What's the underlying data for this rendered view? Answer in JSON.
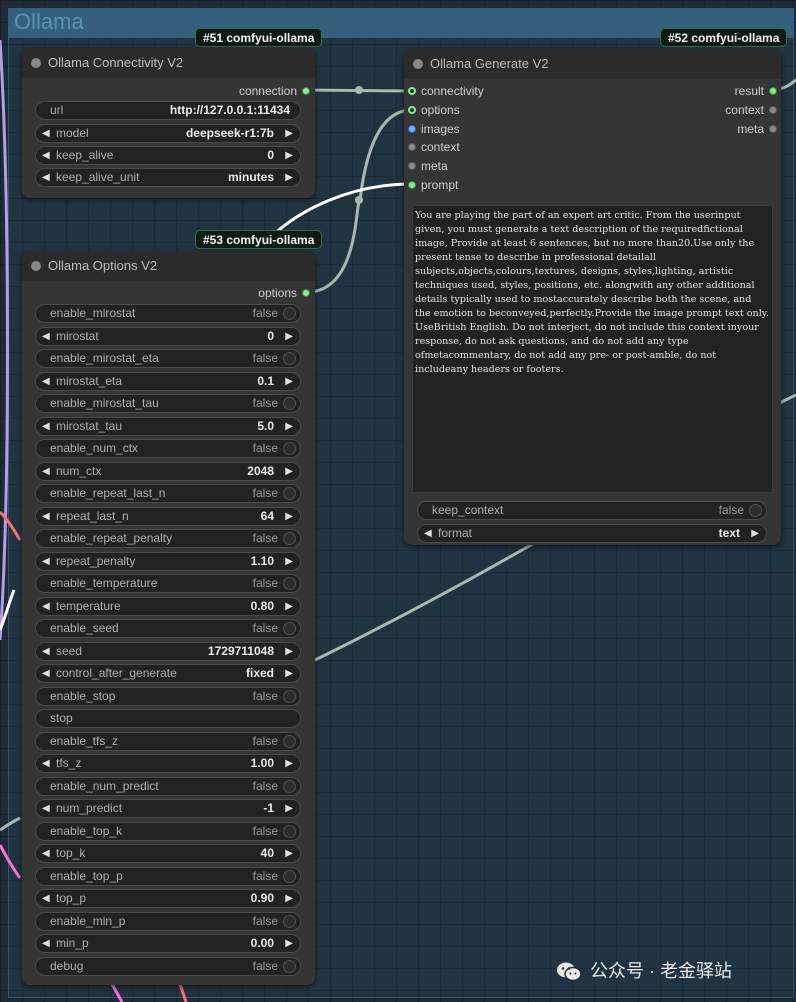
{
  "group": {
    "title": "Ollama"
  },
  "badges": {
    "n51": "#51 comfyui-ollama",
    "n52": "#52 comfyui-ollama",
    "n53": "#53 comfyui-ollama"
  },
  "connectivity": {
    "title": "Ollama Connectivity V2",
    "output": "connection",
    "url_label": "url",
    "url_value": "http://127.0.0.1:11434",
    "model_label": "model",
    "model_value": "deepseek-r1:7b",
    "keep_alive_label": "keep_alive",
    "keep_alive_value": "0",
    "keep_alive_unit_label": "keep_alive_unit",
    "keep_alive_unit_value": "minutes"
  },
  "generate": {
    "title": "Ollama Generate V2",
    "inputs": [
      "connectivity",
      "options",
      "images",
      "context",
      "meta",
      "prompt"
    ],
    "outputs": [
      "result",
      "context",
      "meta"
    ],
    "prompt_text": "You are playing the part of an expert art critic. From the userinput given, you must generate a text description of the requiredfictional image, Provide at least 6 sentences, but no more than20.Use only the present tense to describe in professional detailall subjects,objects,colours,textures, designs, styles,lighting, artistic techniques used, styles, positions, etc. alongwith any other additional details typically used to mostaccurately describe both the scene, and the emotion to beconveyed,perfectly.Provide the image prompt text only. UseBritish English. Do not interject, do not include this context inyour response, do not ask questions, and do not add any type ofmetacommentary, do not add any pre- or post-amble, do not includeany headers or footers.",
    "keep_context_label": "keep_context",
    "keep_context_value": "false",
    "format_label": "format",
    "format_value": "text"
  },
  "options": {
    "title": "Ollama Options V2",
    "output": "options",
    "rows": [
      {
        "label": "enable_mirostat",
        "value": "false",
        "kind": "bool"
      },
      {
        "label": "mirostat",
        "value": "0",
        "kind": "num"
      },
      {
        "label": "enable_mirostat_eta",
        "value": "false",
        "kind": "bool"
      },
      {
        "label": "mirostat_eta",
        "value": "0.1",
        "kind": "num"
      },
      {
        "label": "enable_mirostat_tau",
        "value": "false",
        "kind": "bool"
      },
      {
        "label": "mirostat_tau",
        "value": "5.0",
        "kind": "num"
      },
      {
        "label": "enable_num_ctx",
        "value": "false",
        "kind": "bool"
      },
      {
        "label": "num_ctx",
        "value": "2048",
        "kind": "num"
      },
      {
        "label": "enable_repeat_last_n",
        "value": "false",
        "kind": "bool"
      },
      {
        "label": "repeat_last_n",
        "value": "64",
        "kind": "num"
      },
      {
        "label": "enable_repeat_penalty",
        "value": "false",
        "kind": "bool"
      },
      {
        "label": "repeat_penalty",
        "value": "1.10",
        "kind": "num"
      },
      {
        "label": "enable_temperature",
        "value": "false",
        "kind": "bool"
      },
      {
        "label": "temperature",
        "value": "0.80",
        "kind": "num"
      },
      {
        "label": "enable_seed",
        "value": "false",
        "kind": "bool"
      },
      {
        "label": "seed",
        "value": "1729711048",
        "kind": "num"
      },
      {
        "label": "control_after_generate",
        "value": "fixed",
        "kind": "num"
      },
      {
        "label": "enable_stop",
        "value": "false",
        "kind": "bool"
      },
      {
        "label": "stop",
        "value": "",
        "kind": "text"
      },
      {
        "label": "enable_tfs_z",
        "value": "false",
        "kind": "bool"
      },
      {
        "label": "tfs_z",
        "value": "1.00",
        "kind": "num"
      },
      {
        "label": "enable_num_predict",
        "value": "false",
        "kind": "bool"
      },
      {
        "label": "num_predict",
        "value": "-1",
        "kind": "num"
      },
      {
        "label": "enable_top_k",
        "value": "false",
        "kind": "bool"
      },
      {
        "label": "top_k",
        "value": "40",
        "kind": "num"
      },
      {
        "label": "enable_top_p",
        "value": "false",
        "kind": "bool"
      },
      {
        "label": "top_p",
        "value": "0.90",
        "kind": "num"
      },
      {
        "label": "enable_min_p",
        "value": "false",
        "kind": "bool"
      },
      {
        "label": "min_p",
        "value": "0.00",
        "kind": "num"
      },
      {
        "label": "debug",
        "value": "false",
        "kind": "bool"
      }
    ]
  },
  "watermark": {
    "text": "公众号 · 老金驿站"
  },
  "colors": {
    "canvas_bg": "#1e2b36",
    "node_bg": "#353535",
    "port_green": "#7cf08a",
    "port_blue": "#6fb1ff",
    "link_gray": "#9fb2a8",
    "link_white": "#ffffff"
  }
}
